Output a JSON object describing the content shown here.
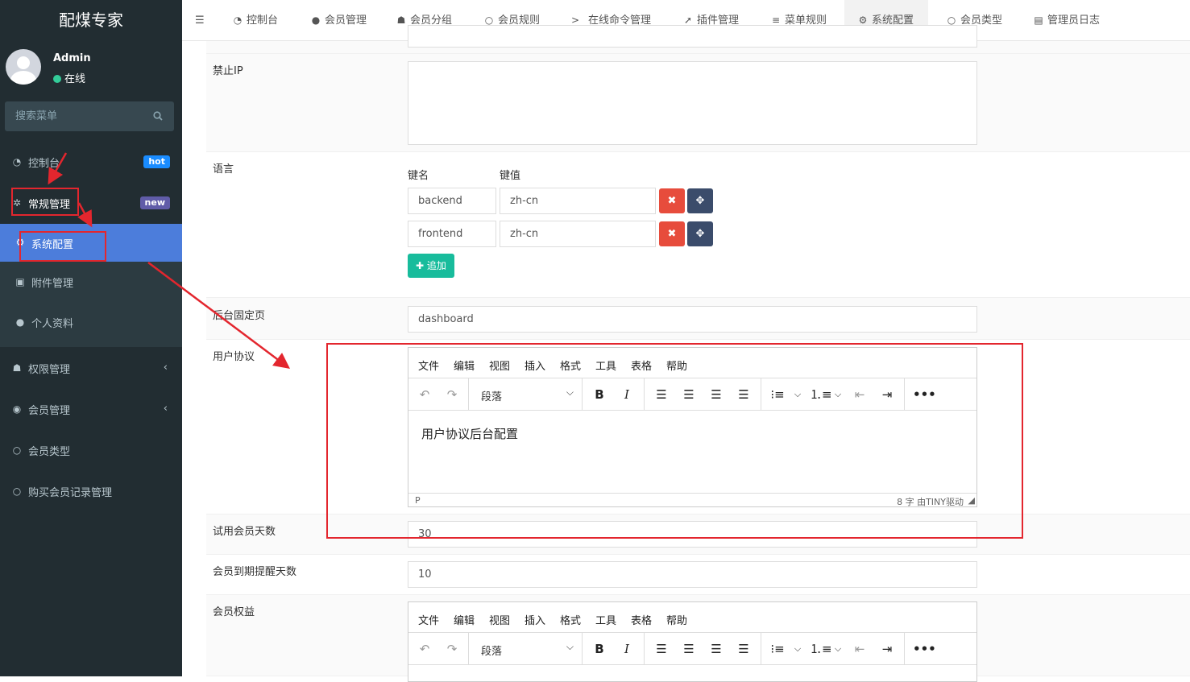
{
  "sidebar": {
    "brand": "配煤专家",
    "user": {
      "name": "Admin",
      "status": "在线"
    },
    "search_placeholder": "搜索菜单",
    "items": [
      {
        "label": "控制台",
        "badge": "hot",
        "badge_color": "#3c8dbc"
      },
      {
        "label": "常规管理",
        "badge": "new",
        "badge_color": "#605ca8"
      },
      {
        "label": "系统配置"
      },
      {
        "label": "附件管理"
      },
      {
        "label": "个人资料"
      },
      {
        "label": "权限管理",
        "chevron": "‹"
      },
      {
        "label": "会员管理",
        "chevron": "‹"
      },
      {
        "label": "会员类型"
      },
      {
        "label": "购买会员记录管理"
      }
    ]
  },
  "tabs": [
    "控制台",
    "会员管理",
    "会员分组",
    "会员规则",
    "在线命令管理",
    "插件管理",
    "菜单规则",
    "系统配置",
    "会员类型",
    "管理员日志"
  ],
  "form": {
    "forbidden_ip": {
      "label": "禁止IP",
      "value": ""
    },
    "language": {
      "label": "语言",
      "key_header": "键名",
      "value_header": "键值",
      "rows": [
        {
          "key": "backend",
          "value": "zh-cn"
        },
        {
          "key": "frontend",
          "value": "zh-cn"
        }
      ],
      "add_label": "追加"
    },
    "fixed_page": {
      "label": "后台固定页",
      "value": "dashboard"
    },
    "user_agreement": {
      "label": "用户协议",
      "menu": [
        "文件",
        "编辑",
        "视图",
        "插入",
        "格式",
        "工具",
        "表格",
        "帮助"
      ],
      "format": "段落",
      "content": "用户协议后台配置",
      "path": "P",
      "footer": "8 字  由TINY驱动"
    },
    "trial_days": {
      "label": "试用会员天数",
      "value": "30"
    },
    "expire_remind": {
      "label": "会员到期提醒天数",
      "value": "10"
    },
    "benefits": {
      "label": "会员权益",
      "menu": [
        "文件",
        "编辑",
        "视图",
        "插入",
        "格式",
        "工具",
        "表格",
        "帮助"
      ],
      "format": "段落"
    }
  },
  "colors": {
    "sidebar_bg": "#222d32",
    "active": "#4c7ddb",
    "highlight": "#e3262e",
    "add_btn": "#18bc9c"
  }
}
